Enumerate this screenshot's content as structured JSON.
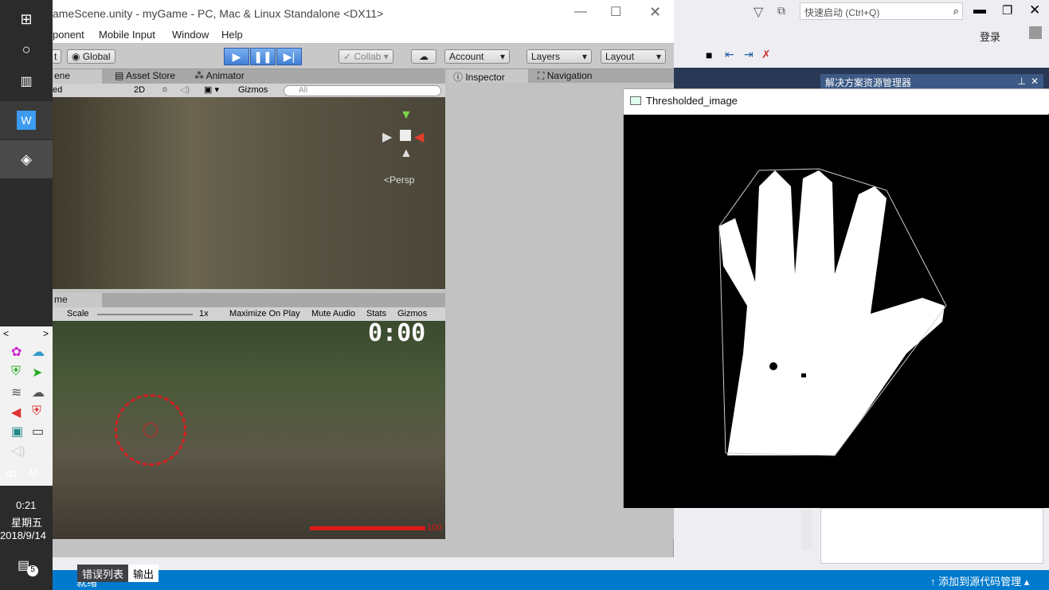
{
  "taskbar": {
    "time": "0:21",
    "weekday": "星期五",
    "date": "2018/9/14",
    "ime_lang": "中",
    "ime_mode": "M",
    "notification_count": "5"
  },
  "vs": {
    "quick_launch_placeholder": "快速启动 (Ctrl+Q)",
    "login": "登录",
    "solution_explorer_title": "解决方案资源管理器",
    "status_right": "添加到源代码管理",
    "status_left": "就绪",
    "bottom_tabs": [
      "错误列表",
      "输出"
    ]
  },
  "unity": {
    "title": "ameScene.unity - myGame - PC, Mac & Linux Standalone <DX11>",
    "menu": [
      "ponent",
      "Mobile Input",
      "Window",
      "Help"
    ],
    "toolbar": {
      "pivot": "t",
      "global": "Global",
      "collab": "Collab",
      "account": "Account",
      "layers": "Layers",
      "layout": "Layout"
    },
    "tabs_top": [
      "ene",
      "Asset Store",
      "Animator"
    ],
    "tabs_right": [
      "Inspector",
      "Navigation"
    ],
    "scene_bar": {
      "shading": "ed",
      "mode_2d": "2D",
      "gizmos": "Gizmos",
      "search_placeholder": "All",
      "persp": "Persp"
    },
    "game_tab": "me",
    "game_bar": {
      "scale_label": "Scale",
      "scale_value": "1x",
      "maximize": "Maximize On Play",
      "mute": "Mute Audio",
      "stats": "Stats",
      "gizmos": "Gizmos"
    },
    "hud": {
      "timer": "0:00",
      "health": "100"
    }
  },
  "opencv": {
    "window_title": "Thresholded_image"
  }
}
